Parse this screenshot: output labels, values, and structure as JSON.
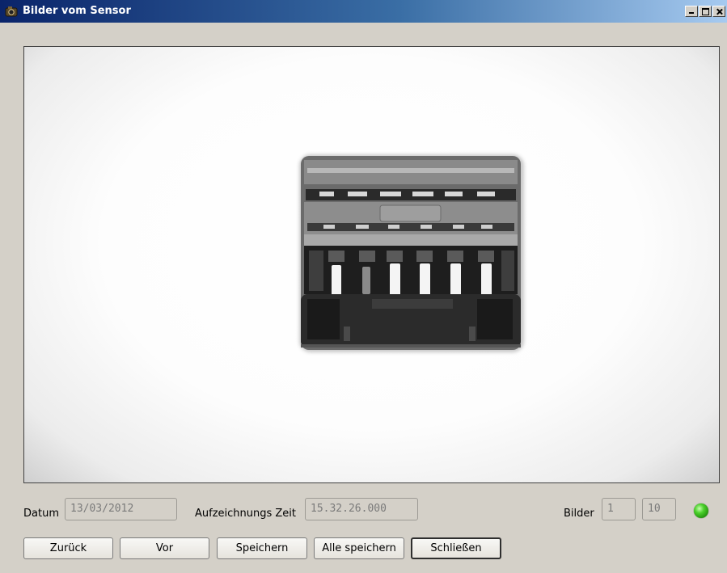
{
  "window": {
    "title": "Bilder vom Sensor",
    "controls": [
      "minimize-icon",
      "maximize-icon",
      "close-icon"
    ]
  },
  "image_view": {
    "subject": "connector-photo"
  },
  "info": {
    "datum_label": "Datum",
    "datum_value": "13/03/2012",
    "zeit_label": "Aufzeichnungs Zeit",
    "zeit_value": "15.32.26.000",
    "bilder_label": "Bilder",
    "bilder_current": "1",
    "bilder_total": "10",
    "status_color": "#2fbf14"
  },
  "buttons": {
    "back": "Zurück",
    "forward": "Vor",
    "save": "Speichern",
    "save_all": "Alle speichern",
    "close": "Schließen"
  }
}
